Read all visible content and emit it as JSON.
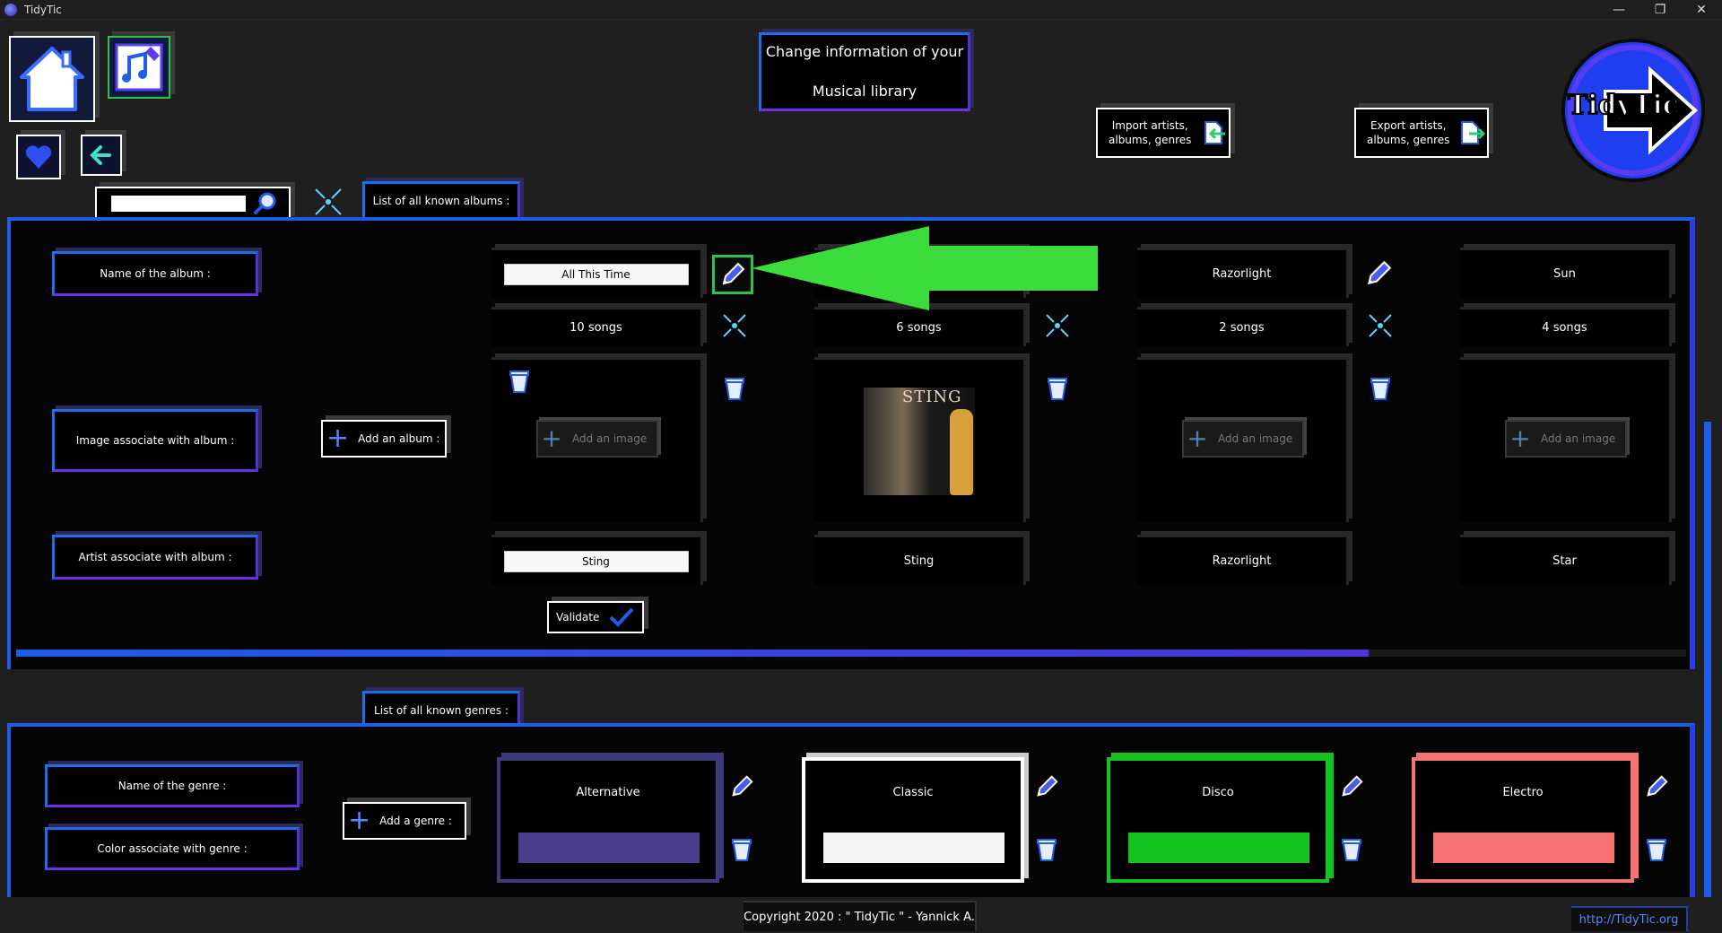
{
  "window": {
    "title": "TidyTic",
    "controls": [
      "—",
      "❐",
      "✕"
    ]
  },
  "header": {
    "title_line1": "Change information of your",
    "title_line2": "Musical library",
    "import_label_line1": "Import artists,",
    "import_label_line2": "albums, genres",
    "export_label_line1": "Export artists,",
    "export_label_line2": "albums, genres",
    "logo_text": "TidyTic"
  },
  "search": {
    "value": "",
    "placeholder": ""
  },
  "albums": {
    "section_label": "List of all known albums :",
    "row_labels": {
      "name": "Name of the album :",
      "image": "Image associate with album :",
      "artist": "Artist associate with album :"
    },
    "add_album_label": "Add an album :",
    "add_image_label": "Add an image",
    "validate_label": "Validate",
    "items": [
      {
        "name": "All This Time",
        "songs": "10 songs",
        "artist": "Sting",
        "has_image": false,
        "editing": true
      },
      {
        "name": "",
        "songs": "6 songs",
        "artist": "Sting",
        "has_image": true,
        "cover_text": "STING",
        "editing": false
      },
      {
        "name": "Razorlight",
        "songs": "2 songs",
        "artist": "Razorlight",
        "has_image": false,
        "editing": false
      },
      {
        "name": "Sun",
        "songs": "4 songs",
        "artist": "Star",
        "has_image": false,
        "editing": false
      }
    ],
    "scroll_fraction": 0.81
  },
  "genres": {
    "section_label": "List of all known genres :",
    "row_labels": {
      "name": "Name of the genre :",
      "color": "Color associate with genre :"
    },
    "add_genre_label": "Add a genre :",
    "items": [
      {
        "name": "Alternative",
        "color": "#4a3e8c",
        "border": "#3f3a7a"
      },
      {
        "name": "Classic",
        "color": "#f5f5f5",
        "border": "#ffffff"
      },
      {
        "name": "Disco",
        "color": "#16c21f",
        "border": "#16c21f"
      },
      {
        "name": "Electro",
        "color": "#f87474",
        "border": "#f87474"
      }
    ]
  },
  "footer": {
    "copyright": "Copyright 2020 : \" TidyTic \" - Yannick A.",
    "link": "http://TidyTic.org"
  },
  "colors": {
    "accent_blue": "#1e5de6",
    "accent_purple": "#6e2ef0",
    "arrow_green": "#3ddc3d"
  }
}
